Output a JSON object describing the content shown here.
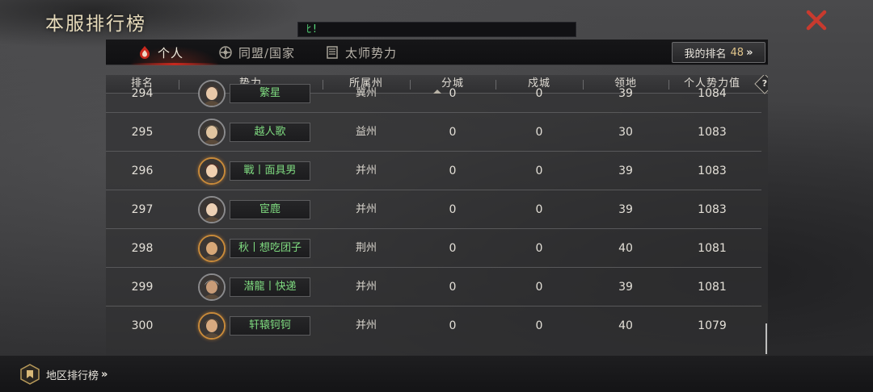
{
  "header": {
    "title": "本服排行榜",
    "chat_text": "ﾋ!"
  },
  "tabs": [
    {
      "label": "个人",
      "icon": "flame-emblem-icon",
      "active": true
    },
    {
      "label": "同盟/国家",
      "icon": "alliance-crest-icon",
      "active": false
    },
    {
      "label": "太师势力",
      "icon": "banner-icon",
      "active": false
    }
  ],
  "my_rank": {
    "label": "我的排名",
    "value": "48",
    "arrow": "»"
  },
  "table": {
    "headers": [
      "排名",
      "势力",
      "所属州",
      "分城",
      "戍城",
      "领地",
      "个人势力值"
    ],
    "help_label": "?",
    "rows": [
      {
        "rank": "294",
        "name": "繁星",
        "province": "冀州",
        "branch": "0",
        "garrison": "0",
        "territory": "39",
        "power": "1084",
        "avatar_color": "#6a4a3a",
        "avatar_skin": "#e8c8a8"
      },
      {
        "rank": "295",
        "name": "越人歌",
        "province": "益州",
        "branch": "0",
        "garrison": "0",
        "territory": "30",
        "power": "1083",
        "avatar_color": "#8a7a5a",
        "avatar_skin": "#e0c4a0"
      },
      {
        "rank": "296",
        "name": "戰丨面具男",
        "province": "并州",
        "branch": "0",
        "garrison": "0",
        "territory": "39",
        "power": "1083",
        "avatar_color": "#7a2a1a",
        "avatar_skin": "#f0d0b0"
      },
      {
        "rank": "297",
        "name": "宦鹿",
        "province": "并州",
        "branch": "0",
        "garrison": "0",
        "territory": "39",
        "power": "1083",
        "avatar_color": "#3a2a22",
        "avatar_skin": "#ecd0b4"
      },
      {
        "rank": "298",
        "name": "秋丨想吃团子",
        "province": "荆州",
        "branch": "0",
        "garrison": "0",
        "territory": "40",
        "power": "1081",
        "avatar_color": "#4a3a2a",
        "avatar_skin": "#d8a878"
      },
      {
        "rank": "299",
        "name": "潜龍丨快递",
        "province": "并州",
        "branch": "0",
        "garrison": "0",
        "territory": "39",
        "power": "1081",
        "avatar_color": "#b8b8b8",
        "avatar_skin": "#c89c78"
      },
      {
        "rank": "300",
        "name": "轩辕钶钶",
        "province": "并州",
        "branch": "0",
        "garrison": "0",
        "territory": "40",
        "power": "1079",
        "avatar_color": "#7a5a3a",
        "avatar_skin": "#d8aa80"
      }
    ]
  },
  "footer": {
    "region_label": "地区排行榜",
    "arrow": "»"
  },
  "colors": {
    "accent_red": "#c8281e",
    "name_green": "#7fdb80",
    "gold": "#e0c48a"
  }
}
